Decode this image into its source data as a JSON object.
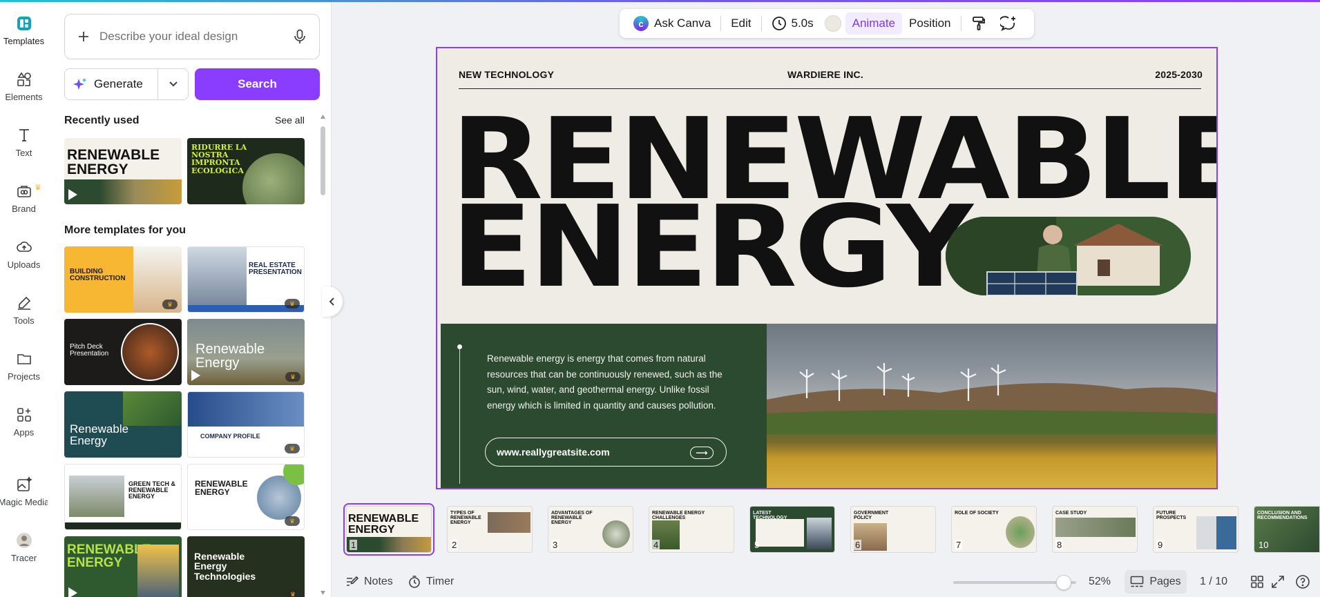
{
  "rail": {
    "items": [
      {
        "label": "Templates",
        "icon": "templates-icon"
      },
      {
        "label": "Elements",
        "icon": "elements-icon"
      },
      {
        "label": "Text",
        "icon": "text-icon"
      },
      {
        "label": "Brand",
        "icon": "brand-icon"
      },
      {
        "label": "Uploads",
        "icon": "uploads-icon"
      },
      {
        "label": "Tools",
        "icon": "tools-icon"
      },
      {
        "label": "Projects",
        "icon": "projects-icon"
      },
      {
        "label": "Apps",
        "icon": "apps-icon"
      },
      {
        "label": "Magic Media",
        "icon": "magic-media-icon"
      },
      {
        "label": "Tracer",
        "icon": "tracer-icon"
      }
    ]
  },
  "panel": {
    "prompt_placeholder": "Describe your ideal design",
    "generate_label": "Generate",
    "search_label": "Search",
    "recently_used": "Recently used",
    "see_all": "See all",
    "more_templates": "More templates for you",
    "recent_templates": [
      {
        "title": "RENEWABLE ENERGY"
      },
      {
        "title": "RIDURRE LA NOSTRA IMPRONTA ECOLOGICA"
      }
    ],
    "templates": [
      {
        "title": "BUILDING CONSTRUCTION"
      },
      {
        "title": "REAL ESTATE PRESENTATION"
      },
      {
        "title": "Pitch Deck Presentation"
      },
      {
        "title": "Renewable Energy"
      },
      {
        "title": "Renewable Energy"
      },
      {
        "title": "COMPANY PROFILE"
      },
      {
        "title": "GREEN TECH & RENEWABLE ENERGY"
      },
      {
        "title": "RENEWABLE ENERGY"
      },
      {
        "title": "RENEWABLE ENERGY"
      },
      {
        "title": "Renewable Energy Technologies"
      }
    ]
  },
  "toolbar": {
    "ask_canva": "Ask Canva",
    "edit": "Edit",
    "duration": "5.0s",
    "animate": "Animate",
    "position": "Position"
  },
  "slide": {
    "header_left": "NEW TECHNOLOGY",
    "header_center": "WARDIERE INC.",
    "header_right": "2025-2030",
    "title_line1": "RENEWABLE",
    "title_line2": "ENERGY",
    "body": "Renewable energy is energy that comes from natural resources that can be continuously renewed, such as the sun, wind, water, and geothermal energy. Unlike fossil energy which is limited in quantity and causes pollution.",
    "url": "www.reallygreatsite.com"
  },
  "filmstrip": [
    {
      "num": "1",
      "title": "RENEWABLE ENERGY"
    },
    {
      "num": "2",
      "title": "TYPES OF RENEWABLE ENERGY"
    },
    {
      "num": "3",
      "title": "ADVANTAGES OF RENEWABLE ENERGY"
    },
    {
      "num": "4",
      "title": "RENEWABLE ENERGY CHALLENGES"
    },
    {
      "num": "5",
      "title": "LATEST TECHNOLOGY"
    },
    {
      "num": "6",
      "title": "GOVERNMENT POLICY"
    },
    {
      "num": "7",
      "title": "ROLE OF SOCIETY"
    },
    {
      "num": "8",
      "title": "CASE STUDY"
    },
    {
      "num": "9",
      "title": "FUTURE PROSPECTS"
    },
    {
      "num": "10",
      "title": "CONCLUSION AND RECOMMENDATIONS"
    }
  ],
  "bottombar": {
    "notes": "Notes",
    "timer": "Timer",
    "zoom": "52%",
    "pages": "Pages",
    "page_count": "1 / 10"
  },
  "colors": {
    "accent": "#8b3dff",
    "slide_green": "#2c4a2f",
    "slide_bg": "#eeece4"
  }
}
